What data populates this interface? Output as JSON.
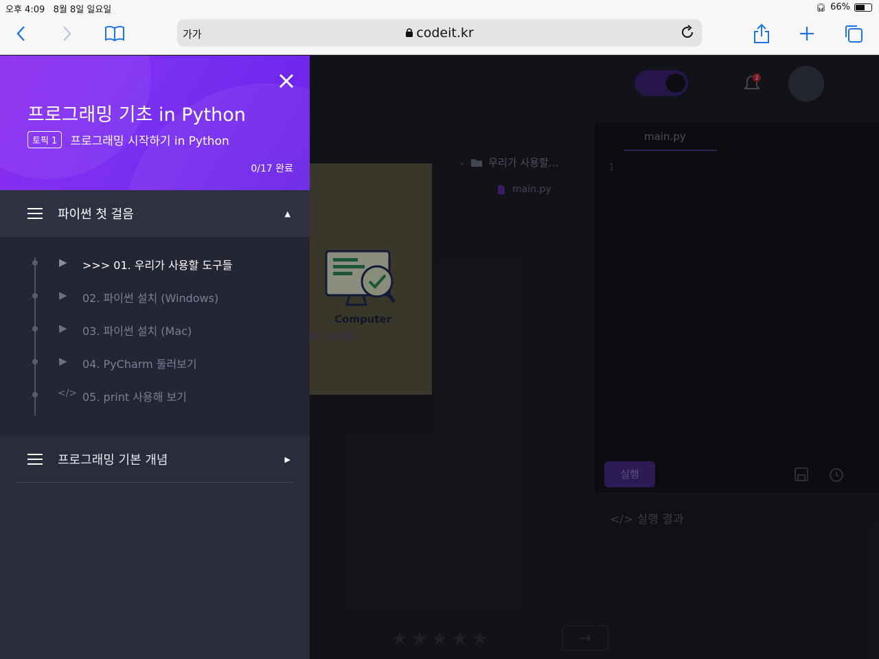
{
  "status_bar": {
    "time": "오후 4:09",
    "date": "8월 8일 일요일",
    "battery": "66%",
    "battery_level": 0.66
  },
  "browser": {
    "text_size": "가가",
    "url": "codeit.kr"
  },
  "drawer": {
    "title": "프로그래밍 기초 in Python",
    "topic_badge": "토픽 1",
    "topic_name": "프로그래밍 시작하기 in Python",
    "progress": "0/17 완료",
    "sections": [
      {
        "title": "파이썬 첫 걸음",
        "expanded": true,
        "lessons": [
          {
            "label": ">>> 01. 우리가 사용할 도구들",
            "icon": "play-icon",
            "active": true
          },
          {
            "label": "02. 파이썬 설치 (Windows)",
            "icon": "play-icon",
            "active": false
          },
          {
            "label": "03. 파이썬 설치 (Mac)",
            "icon": "play-icon",
            "active": false
          },
          {
            "label": "04. PyCharm 둘러보기",
            "icon": "play-icon",
            "active": false
          },
          {
            "label": "05. print 사용해 보기",
            "icon": "code-icon",
            "active": false
          }
        ]
      },
      {
        "title": "프로그래밍 기본 개념",
        "expanded": false
      }
    ]
  },
  "background": {
    "video_label": "Computer",
    "video_sub": "주는 프로그램",
    "folder_name": "우리가 사용할…",
    "file_name": "main.py",
    "editor_tab": "main.py",
    "line_number": "1",
    "run_button": "실행",
    "result_label": "</> 실행 결과",
    "notification_count": "2",
    "next_arrow": "→"
  }
}
